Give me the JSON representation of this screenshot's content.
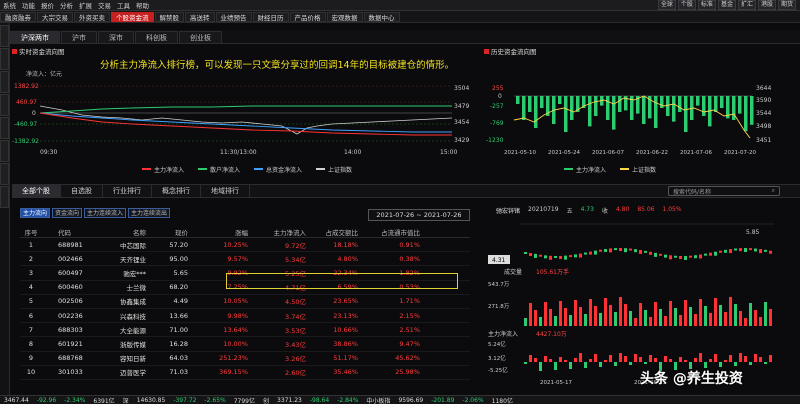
{
  "toolbar": {
    "items": [
      "系统",
      "功能",
      "报价",
      "分析",
      "扩展",
      "交易",
      "工具",
      "帮助"
    ],
    "right": [
      "全球",
      "个股",
      "标准",
      "基金",
      "扩汇",
      "港股",
      "期货"
    ]
  },
  "nav": {
    "items": [
      "融资融券",
      "大宗交易",
      "外资买卖",
      "个股资金流",
      "解禁股",
      "高送转",
      "业绩预告",
      "财经日历",
      "产品价格",
      "宏观数据",
      "数据中心"
    ],
    "active": 3
  },
  "market_tabs": {
    "items": [
      "沪深两市",
      "沪市",
      "深市",
      "科创板",
      "创业板"
    ],
    "active": 0
  },
  "flow_panel": {
    "title": "实时资金流向图",
    "unit": "净流入：亿元",
    "y_labels": [
      "1382.92",
      "460.97",
      "0",
      "-460.97",
      "-1382.92"
    ],
    "y_right": [
      "3504",
      "3479",
      "3454",
      "3429"
    ],
    "x_labels": [
      "09:30",
      "11:30/13:00",
      "14:00",
      "15:00"
    ],
    "legend": [
      "主力净流入",
      "散户净流入",
      "总资金净流入",
      "上证指数"
    ],
    "colors": [
      "#ff3333",
      "#2ecc71",
      "#3fa0ff",
      "#d0d0d0"
    ]
  },
  "hist_panel": {
    "title": "历史资金流向图",
    "y_labels": [
      "255",
      "0",
      "-257",
      "-769",
      "-1230"
    ],
    "y_right": [
      "3644",
      "3590",
      "3544",
      "3498",
      "3451"
    ],
    "x_labels": [
      "2021-05-10",
      "2021-05-24",
      "2021-06-07",
      "2021-06-22",
      "2021-07-06",
      "2021-07-20"
    ],
    "legend": [
      "主力净流入",
      "上证指数"
    ],
    "colors": [
      "#2ecc71",
      "#ffd54a"
    ]
  },
  "annotation": "分析主力净流入排行榜，可以发现一只文章分享过的回调14年的目标被建仓的情形。",
  "sub_tabs": {
    "items": [
      "全部个股",
      "自选股",
      "行业排行",
      "概念排行",
      "地域排行"
    ],
    "active": 0
  },
  "search": {
    "placeholder": "搜索代码/名称"
  },
  "filters": {
    "items": [
      "主力流向",
      "资金流向",
      "主力连续流入",
      "主力连续流出"
    ],
    "active": 0
  },
  "date_range": "2021-07-26 ~ 2021-07-26",
  "table": {
    "headers": [
      "序号",
      "代码",
      "名称",
      "现价",
      "涨幅",
      "主力净流入",
      "占成交额比",
      "占流通市值比"
    ],
    "rows": [
      [
        "1",
        "688981",
        "中芯国际",
        "57.20",
        "10.25%",
        "9.72亿",
        "18.18%",
        "0.91%"
      ],
      [
        "2",
        "002466",
        "天齐锂业",
        "95.00",
        "9.57%",
        "5.34亿",
        "4.80%",
        "0.38%"
      ],
      [
        "3",
        "600497",
        "驰宏***",
        "5.65",
        "9.92%",
        "5.25亿",
        "22.34%",
        "1.82%"
      ],
      [
        "4",
        "600460",
        "士兰微",
        "68.20",
        "7.25%",
        "4.71亿",
        "6.59%",
        "0.53%"
      ],
      [
        "5",
        "002506",
        "协鑫集成",
        "4.49",
        "10.05%",
        "4.50亿",
        "23.65%",
        "1.71%"
      ],
      [
        "6",
        "002236",
        "兴森科技",
        "13.66",
        "9.98%",
        "3.74亿",
        "23.13%",
        "2.15%"
      ],
      [
        "7",
        "688303",
        "大全能源",
        "71.00",
        "13.64%",
        "3.53亿",
        "10.66%",
        "2.51%"
      ],
      [
        "8",
        "601921",
        "浙版传媒",
        "16.28",
        "10.00%",
        "3.43亿",
        "38.86%",
        "9.47%"
      ],
      [
        "9",
        "688768",
        "容知日新",
        "64.03",
        "251.23%",
        "3.26亿",
        "51.17%",
        "45.62%"
      ],
      [
        "10",
        "301033",
        "迈普医学",
        "71.03",
        "369.15%",
        "2.60亿",
        "35.46%",
        "25.98%"
      ]
    ]
  },
  "stock": {
    "name": "驰宏锌锗",
    "date": "20210719",
    "five": "五",
    "price": "4.73",
    "vol_label": "收",
    "vol": "4.80",
    "change": "85.06",
    "pct": "1.05%",
    "high": "5.85",
    "last": "4.31",
    "vol_bar_label": "成交量",
    "vol_value": "105.61万手",
    "main_label": "主力净流入",
    "main_value": "4427.10万",
    "vol_axis": [
      "543.7万",
      "271.8万"
    ],
    "main_axis": [
      "5.24亿",
      "3.12亿",
      "-5.25亿"
    ],
    "dates": [
      "2021-05-17",
      "2021-06-21"
    ]
  },
  "bottom": {
    "items": [
      "3467.44",
      "-92.96",
      "-2.34%",
      "6391亿",
      "深",
      "14630.85",
      "-397.72",
      "-2.65%",
      "7799亿",
      "创",
      "3371.23",
      "-98.64",
      "-2.84%",
      "中小板指",
      "9596.69",
      "-201.89",
      "-2.06%",
      "1180亿"
    ]
  },
  "watermark": "头条 @养生投资"
}
